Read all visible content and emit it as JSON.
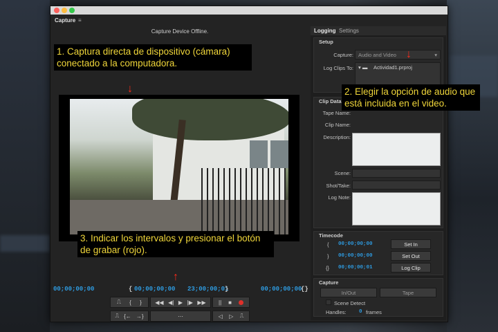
{
  "window": {
    "panel_tab": "Capture",
    "panel_menu": "≡",
    "status": "Capture Device Offline."
  },
  "timecodes": {
    "current": "00;00;00;00",
    "in_brace": "{",
    "in_point": "00;00;00;00",
    "out_point": "23;00;00;01",
    "out_brace": "}",
    "duration": "00;00;00;00",
    "duration_icon": "{}"
  },
  "transport": {
    "row1": [
      "⎍",
      "{",
      "}",
      "◀◀",
      "◀|",
      "▶",
      "|▶",
      "▶▶",
      "||",
      "■",
      "●"
    ],
    "row2": [
      "⎍",
      "{←",
      "→}",
      "⋯",
      "◁",
      "▷",
      "⎍"
    ]
  },
  "right_panel": {
    "tabs": [
      "Logging",
      "Settings"
    ],
    "setup": {
      "title": "Setup",
      "capture_label": "Capture:",
      "capture_value": "Audio and Video",
      "log_clips_label": "Log Clips To:",
      "log_clips_value": "Actividad1.prproj"
    },
    "clip_data": {
      "title": "Clip Data",
      "tape_name_label": "Tape Name:",
      "clip_name_label": "Clip Name:",
      "description_label": "Description:",
      "scene_label": "Scene:",
      "shot_label": "Shot/Take:",
      "log_note_label": "Log Note:"
    },
    "timecode": {
      "title": "Timecode",
      "in_icon": "{",
      "in_value": "00;00;00;00",
      "set_in": "Set In",
      "out_icon": "}",
      "out_value": "00;00;00;00",
      "set_out": "Set Out",
      "dur_icon": "{}",
      "dur_value": "00;00;00;01",
      "log_clip": "Log Clip"
    },
    "capture": {
      "title": "Capture",
      "in_out": "In/Out",
      "tape": "Tape",
      "scene_detect": "Scene Detect",
      "handles_label": "Handles:",
      "handles_value": "0",
      "handles_unit": "frames"
    }
  },
  "annotations": {
    "note1": "1. Captura directa de dispositivo (cámara) conectado a la computadora.",
    "note2": "2. Elegir la opción de audio que está incluida en el video.",
    "note3": "3. Indicar los intervalos y presionar el botón de grabar (rojo)."
  },
  "colors": {
    "timecode_blue": "#2e9be0",
    "annotation_yellow": "#f0d63a",
    "arrow_red": "#ff2a1a",
    "record_red": "#e0302a"
  }
}
